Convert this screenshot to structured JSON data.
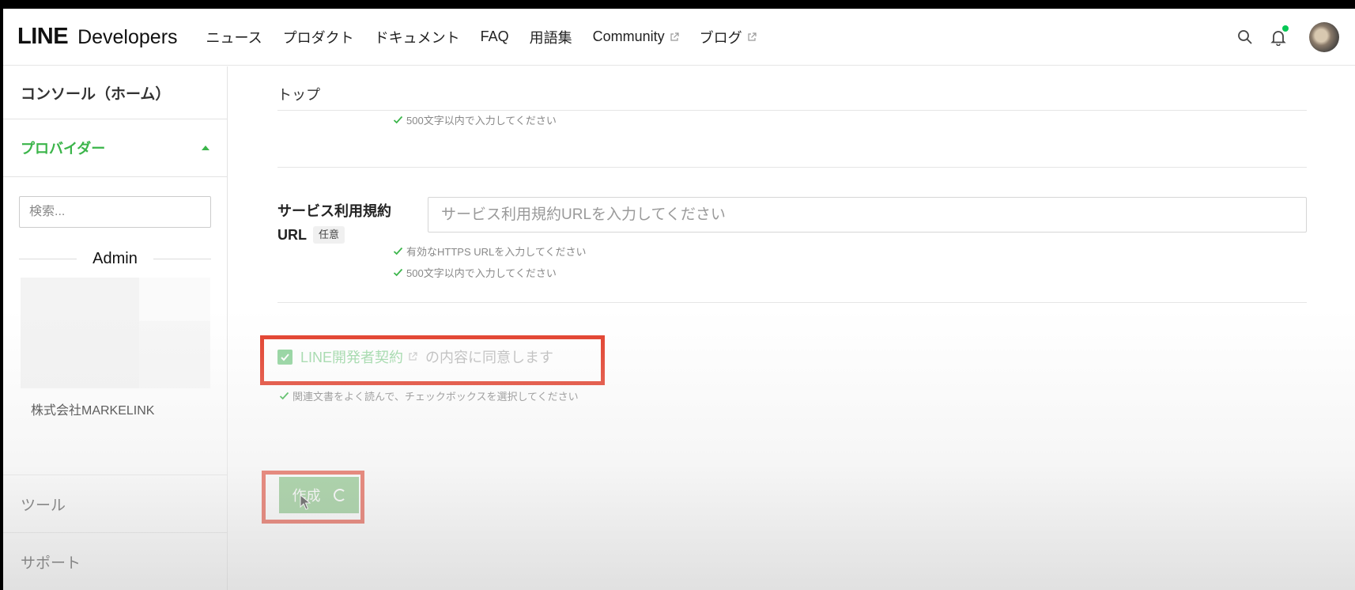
{
  "header": {
    "logo_line": "LINE",
    "logo_dev": "Developers",
    "nav": [
      {
        "label": "ニュース",
        "external": false
      },
      {
        "label": "プロダクト",
        "external": false
      },
      {
        "label": "ドキュメント",
        "external": false
      },
      {
        "label": "FAQ",
        "external": false
      },
      {
        "label": "用語集",
        "external": false
      },
      {
        "label": "Community",
        "external": true
      },
      {
        "label": "ブログ",
        "external": true
      }
    ]
  },
  "sidebar": {
    "home": "コンソール（ホーム）",
    "provider": "プロバイダー",
    "search_placeholder": "検索...",
    "group_label": "Admin",
    "company": "株式会社MARKELINK",
    "tools": "ツール",
    "support": "サポート"
  },
  "main": {
    "breadcrumb": "トップ",
    "hint_top": "500文字以内で入力してください",
    "field": {
      "label_line1": "サービス利用規約",
      "label_line2": "URL",
      "optional": "任意",
      "placeholder": "サービス利用規約URLを入力してください",
      "value": ""
    },
    "hint_https": "有効なHTTPS URLを入力してください",
    "hint_500": "500文字以内で入力してください",
    "agree_link": "LINE開発者契約",
    "agree_text": "の内容に同意します",
    "hint_checkbox": "関連文書をよく読んで、チェックボックスを選択してください",
    "create_button": "作成"
  },
  "colors": {
    "brand_green": "#3bb54a",
    "button_green": "#7bbf78",
    "highlight_red": "#e23a26"
  }
}
